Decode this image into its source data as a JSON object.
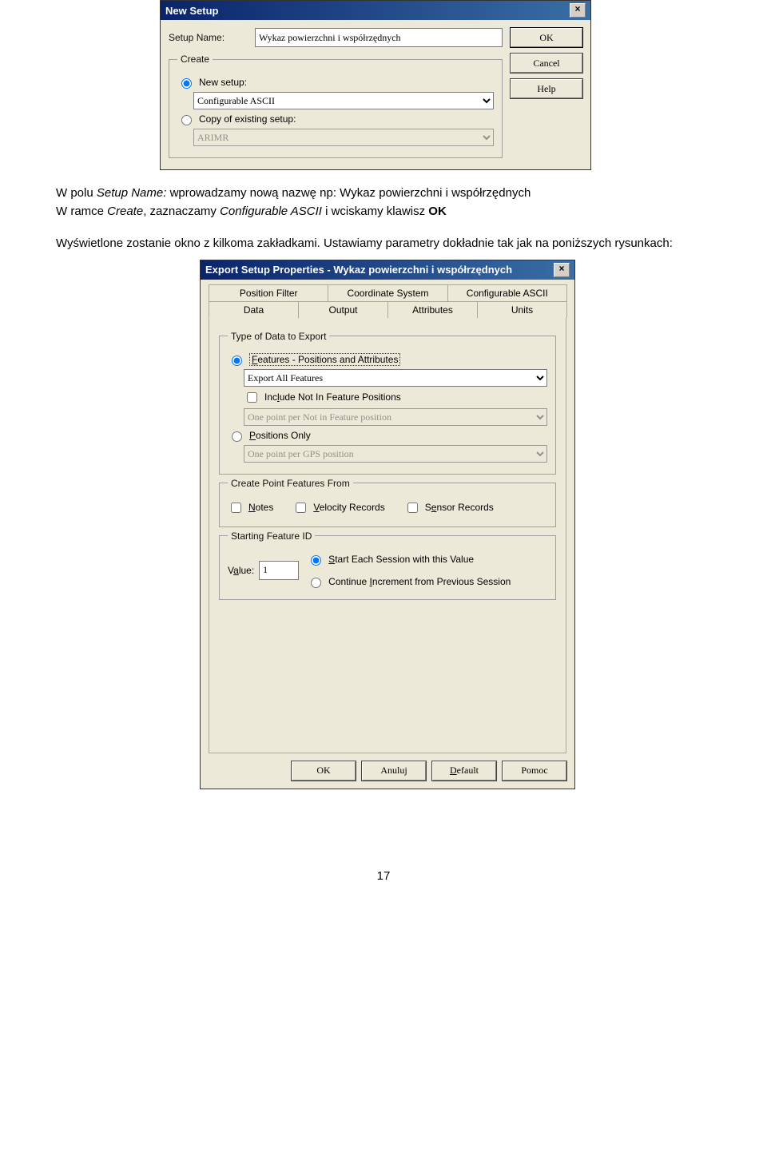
{
  "dialog1": {
    "title": "New Setup",
    "setup_name_label": "Setup Name:",
    "setup_name_value": "Wykaz powierzchni i współrzędnych",
    "create_legend": "Create",
    "new_setup_label": "New setup:",
    "new_setup_value": "Configurable ASCII",
    "copy_label": "Copy of existing setup:",
    "copy_value": "ARIMR",
    "ok": "OK",
    "cancel": "Cancel",
    "help": "Help"
  },
  "para1_pre": "W polu ",
  "para1_i1": "Setup Name:",
  "para1_mid1": " wprowadzamy nową nazwę np: Wykaz powierzchni i współrzędnych",
  "para2_pre": "W ramce ",
  "para2_i1": "Create",
  "para2_mid1": ", zaznaczamy ",
  "para2_i2": "Configurable ASCII ",
  "para2_mid2": " i wciskamy klawisz ",
  "para2_b": "OK",
  "para3": "Wyświetlone zostanie okno z kilkoma zakładkami. Ustawiamy parametry dokładnie tak jak na poniższych rysunkach:",
  "dialog2": {
    "title": "Export Setup Properties - Wykaz powierzchni i współrzędnych",
    "tabs_top": [
      "Position Filter",
      "Coordinate System",
      "Configurable ASCII"
    ],
    "tabs_bottom": [
      "Data",
      "Output",
      "Attributes",
      "Units"
    ],
    "type_legend": "Type of Data to Export",
    "features_label": "Features - Positions and Attributes",
    "export_all": "Export All Features",
    "include_not_in": "Include Not In Feature Positions",
    "one_point_notin": "One point per Not in Feature position",
    "positions_only": "Positions Only",
    "one_point_gps": "One point per GPS position",
    "create_point_legend": "Create Point Features From",
    "notes": "Notes",
    "velocity": "Velocity Records",
    "sensor": "Sensor Records",
    "starting_legend": "Starting Feature ID",
    "value_label": "Value:",
    "value_val": "1",
    "start_each": "Start Each Session with this Value",
    "continue_inc": "Continue Increment from Previous Session",
    "ok": "OK",
    "anuluj": "Anuluj",
    "default": "Default",
    "pomoc": "Pomoc"
  },
  "page_number": "17"
}
